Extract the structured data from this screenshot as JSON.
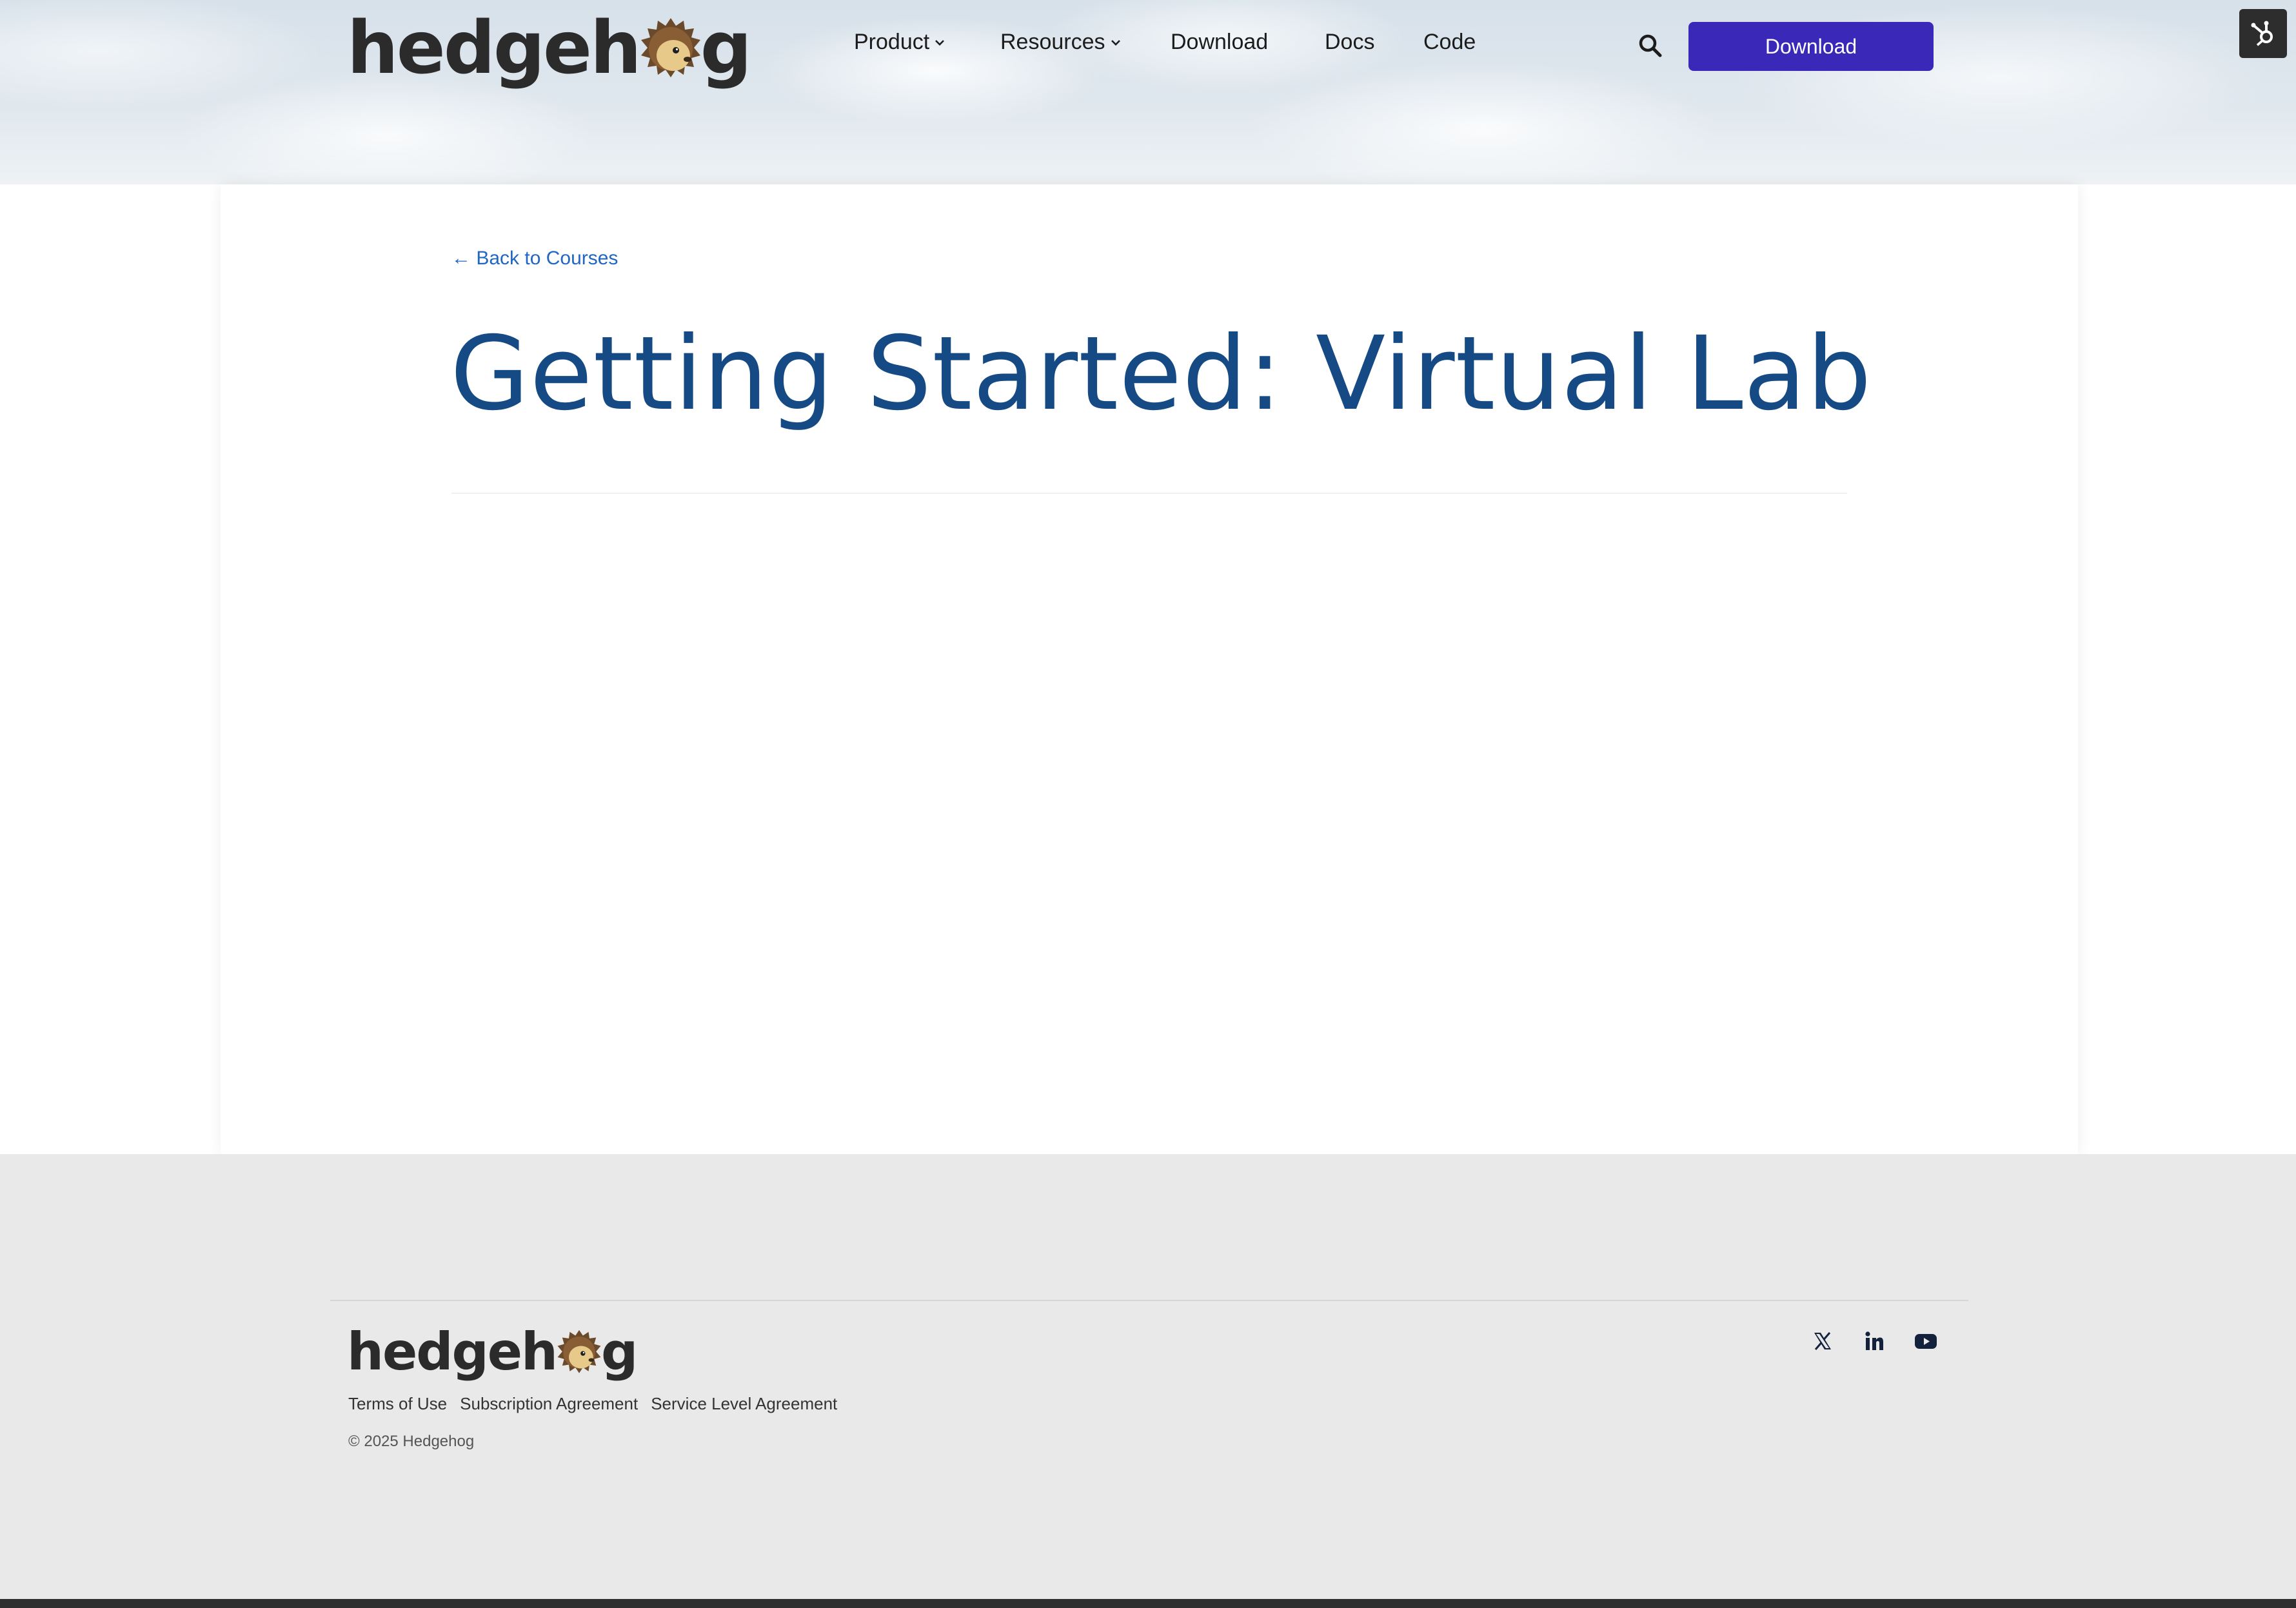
{
  "brand": {
    "name_part1": "hedgeh",
    "name_part2": "g",
    "logo_icon": "hedgehog-o-icon",
    "colors": {
      "quill_dark": "#6b4a2b",
      "quill_light": "#9a6a3c",
      "face": "#e7c98a",
      "wordmark": "#2b2b2b"
    }
  },
  "nav": {
    "items": [
      {
        "label": "Product",
        "has_dropdown": true
      },
      {
        "label": "Resources",
        "has_dropdown": true
      },
      {
        "label": "Download",
        "has_dropdown": false
      },
      {
        "label": "Docs",
        "has_dropdown": false
      },
      {
        "label": "Code",
        "has_dropdown": false
      }
    ],
    "search_icon": "search-icon",
    "cta_label": "Download",
    "cta_color": "#3a28b8",
    "badge_icon": "hubspot-sprocket-icon"
  },
  "main": {
    "back_link": "← Back to Courses",
    "title": "Getting Started: Virtual Lab",
    "link_color": "#2166c2",
    "title_color": "#154a85"
  },
  "footer": {
    "links": [
      "Terms of Use",
      "Subscription Agreement",
      "Service Level Agreement"
    ],
    "copyright": "© 2025 Hedgehog",
    "social": [
      "x-twitter-icon",
      "linkedin-icon",
      "youtube-icon"
    ],
    "background": "#e9e9e9"
  }
}
